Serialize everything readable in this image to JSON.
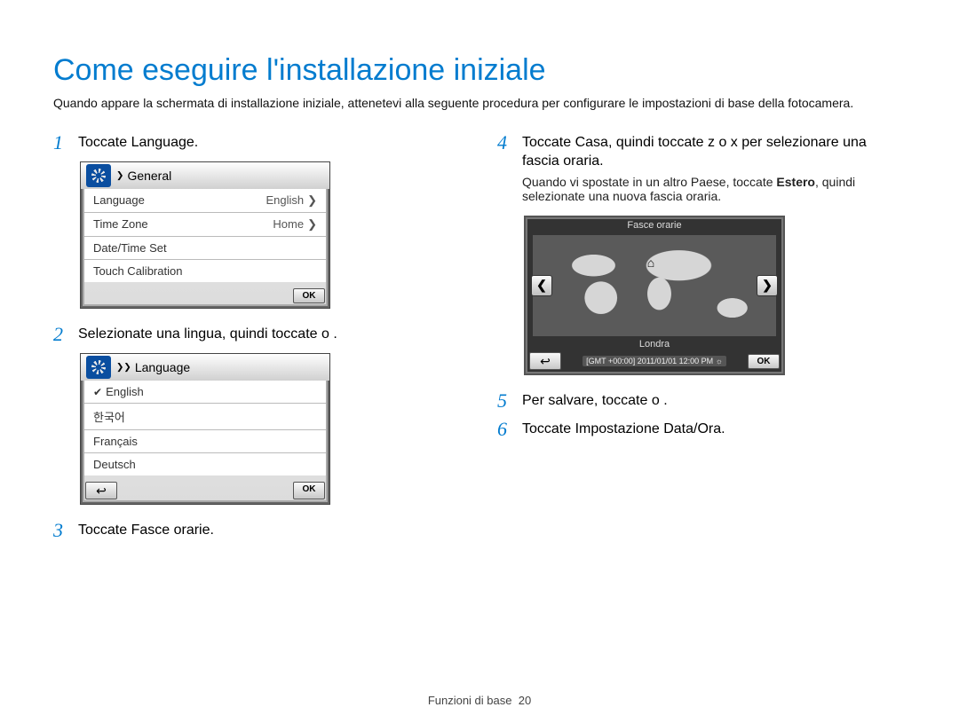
{
  "title": "Come eseguire l'installazione iniziale",
  "intro": "Quando appare la schermata di installazione iniziale, attenetevi alla seguente procedura per configurare le impostazioni di base della fotocamera.",
  "steps": {
    "s1": {
      "num": "1",
      "text": "Toccate Language."
    },
    "s2": {
      "num": "2",
      "text": "Selezionate una lingua, quindi toccate o ."
    },
    "s3": {
      "num": "3",
      "text": "Toccate Fasce orarie."
    },
    "s4": {
      "num": "4",
      "text": "Toccate Casa, quindi toccate z o x per selezionare una fascia oraria."
    },
    "s4_note_a": "Quando vi spostate in un altro Paese, toccate ",
    "s4_note_bold": "Estero",
    "s4_note_b": ", quindi selezionate una nuova fascia oraria.",
    "s5": {
      "num": "5",
      "text": "Per salvare, toccate o ."
    },
    "s6": {
      "num": "6",
      "text": "Toccate Impostazione Data/Ora."
    }
  },
  "screen_general": {
    "header_chev": "❯",
    "title": "General",
    "rows": [
      {
        "label": "Language",
        "value": "English",
        "chev": "❯"
      },
      {
        "label": "Time Zone",
        "value": "Home",
        "chev": "❯"
      },
      {
        "label": "Date/Time Set",
        "value": ""
      },
      {
        "label": "Touch Calibration",
        "value": ""
      }
    ],
    "ok": "OK"
  },
  "screen_language": {
    "header_chev": "❯❯",
    "title": "Language",
    "options": [
      {
        "label": "English",
        "checked": true
      },
      {
        "label": "한국어"
      },
      {
        "label": "Français"
      },
      {
        "label": "Deutsch"
      }
    ],
    "back": "↩",
    "ok": "OK"
  },
  "screen_timezone": {
    "title": "Fasce orarie",
    "location": "Londra",
    "time": "[GMT +00:00] 2011/01/01 12:00 PM ☼",
    "back": "↩",
    "ok": "OK",
    "arrow_left": "❮",
    "arrow_right": "❯",
    "home_icon": "⌂"
  },
  "footer": {
    "label": "Funzioni di base",
    "page": "20"
  }
}
